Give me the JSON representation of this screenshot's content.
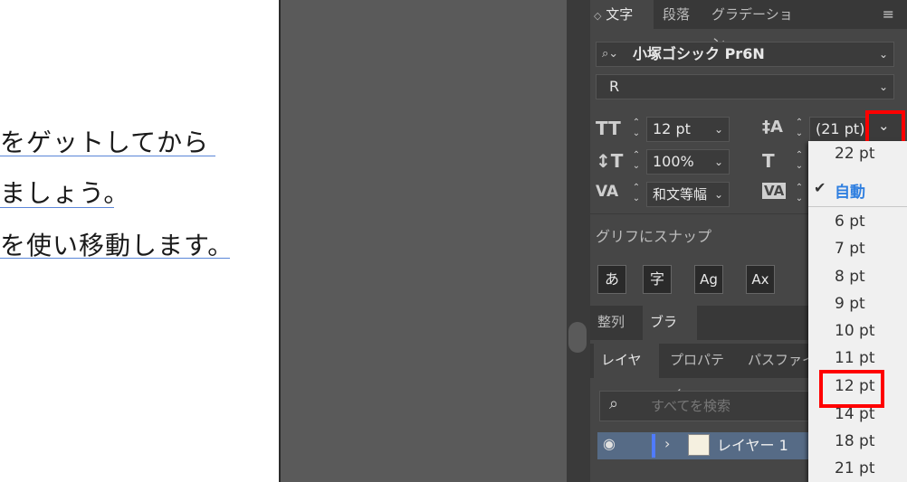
{
  "document": {
    "lines": [
      "をゲットしてから",
      "ましょう。",
      "を使い移動します。"
    ]
  },
  "character_panel": {
    "tabs": [
      "文字",
      "段落",
      "グラデーション"
    ],
    "font_family": "小塚ゴシック Pr6N",
    "font_style": "R",
    "font_size": "12 pt",
    "leading": "(21 pt)",
    "vertical_scale": "100%",
    "kerning": "和文等幅",
    "snap_label": "グリフにスナップ",
    "snap_buttons": [
      "あ",
      "字",
      "Ag",
      "Ax"
    ]
  },
  "lower_tabs": [
    "整列",
    "ブラシ"
  ],
  "layers_tabs": [
    "レイヤー",
    "プロパティ",
    "パスファインダ"
  ],
  "layers": {
    "search_placeholder": "すべてを検索",
    "layer_name": "レイヤー 1"
  },
  "leading_dropdown": {
    "items": [
      "22 pt",
      "自動",
      "6 pt",
      "7 pt",
      "8 pt",
      "9 pt",
      "10 pt",
      "11 pt",
      "12 pt",
      "14 pt",
      "18 pt",
      "21 pt"
    ],
    "checked": "自動",
    "highlighted": "12 pt"
  },
  "colors": {
    "highlight_red": "#ff0000",
    "checked_blue": "#2f7fe0",
    "layer_color": "#4f7bff"
  }
}
